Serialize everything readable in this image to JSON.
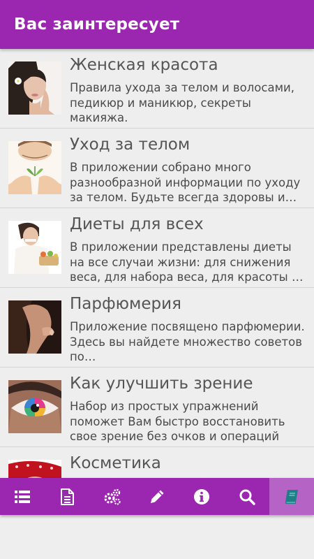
{
  "app_bar": {
    "title": "Вас заинтересует"
  },
  "items": [
    {
      "title": "Женская красота",
      "description": "Правила ухода за телом и волосами, педикюр и маникюр, секреты макияжа.",
      "image_icon": "woman-beauty-photo"
    },
    {
      "title": "Уход за телом",
      "description": "В приложении собрано много разнообразной информации по уходу за телом. Будьте всегда здоровы и…",
      "image_icon": "body-care-photo"
    },
    {
      "title": "Диеты для всех",
      "description": "В приложении представлены диеты на все случаи жизни: для снижения веса, для набора веса, для красоты …",
      "image_icon": "diet-photo"
    },
    {
      "title": "Парфюмерия",
      "description": "Приложение посвящено парфюмерии. Здесь вы найдете множество советов по…",
      "image_icon": "perfume-photo"
    },
    {
      "title": "Как улучшить зрение",
      "description": "Набор из простых упражнений поможет Вам быстро восстановить свое зрение без очков и операций",
      "image_icon": "eye-photo"
    },
    {
      "title": "Косметика",
      "description": "",
      "image_icon": "cosmetics-photo"
    }
  ],
  "bottom_nav": [
    {
      "icon": "list-icon",
      "active": false
    },
    {
      "icon": "document-icon",
      "active": false
    },
    {
      "icon": "gears-icon",
      "active": false
    },
    {
      "icon": "pencil-icon",
      "active": false
    },
    {
      "icon": "info-icon",
      "active": false
    },
    {
      "icon": "search-icon",
      "active": false
    },
    {
      "icon": "book-icon",
      "active": true
    }
  ],
  "colors": {
    "primary": "#9b27b0",
    "active_tab": "#b663c6",
    "active_icon": "#1e7f86",
    "background": "#eeeeee"
  }
}
